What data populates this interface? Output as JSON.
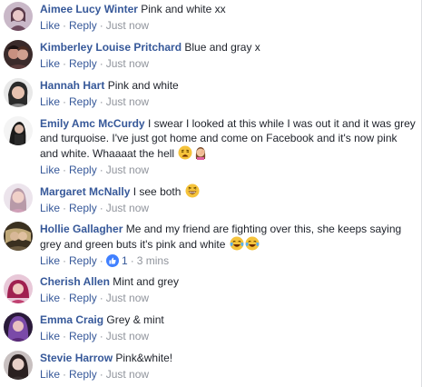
{
  "actions": {
    "like": "Like",
    "reply": "Reply",
    "sep": "·"
  },
  "comments": [
    {
      "author": "Aimee Lucy Winter",
      "text": "Pink and white xx",
      "time": "Just now"
    },
    {
      "author": "Kimberley Louise Pritchard",
      "text": "Blue and gray x",
      "time": "Just now"
    },
    {
      "author": "Hannah Hart",
      "text": "Pink and white",
      "time": "Just now"
    },
    {
      "author": "Emily Amc McCurdy",
      "text": "I swear I looked at this while I was out it and it was grey and turquoise. I've just got home and come on Facebook and it's now pink and white. Whaaaat the hell",
      "emoji": [
        "tired-face-icon",
        "woman-facepalming-icon"
      ],
      "time": "Just now"
    },
    {
      "author": "Margaret McNally",
      "text": "I see both",
      "emoji": [
        "laughing-face-icon"
      ],
      "time": "Just now"
    },
    {
      "author": "Hollie Gallagher",
      "text": "Me and my friend are fighting over this, she keeps saying grey and green buts it's pink and white",
      "emoji": [
        "crying-laughing-icon",
        "crying-laughing-icon"
      ],
      "time": "3 mins",
      "likes": "1"
    },
    {
      "author": "Cherish Allen",
      "text": "Mint and grey",
      "time": "Just now"
    },
    {
      "author": "Emma Craig",
      "text": "Grey & mint",
      "time": "Just now"
    },
    {
      "author": "Stevie Harrow",
      "text": "Pink&white!",
      "time": "Just now"
    }
  ],
  "colors": {
    "author": "#365899",
    "meta": "#90949c",
    "text": "#1d2129",
    "like_badge": "#4080ff"
  }
}
